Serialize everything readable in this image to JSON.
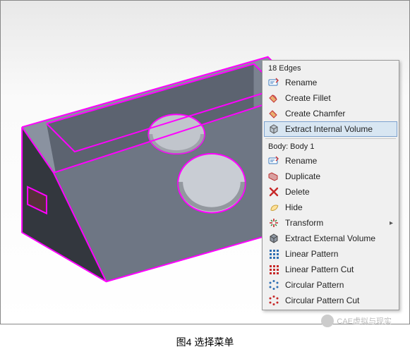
{
  "caption": "图4 选择菜单",
  "watermark_text": "CAE虚拟与现实",
  "menu": {
    "header_edges": "18 Edges",
    "header_body": "Body: Body 1",
    "edges_items": {
      "rename": "Rename",
      "create_fillet": "Create Fillet",
      "create_chamfer": "Create Chamfer",
      "extract_internal_volume": "Extract Internal Volume"
    },
    "body_items": {
      "rename": "Rename",
      "duplicate": "Duplicate",
      "delete": "Delete",
      "hide": "Hide",
      "transform": "Transform",
      "extract_external_volume": "Extract External Volume",
      "linear_pattern": "Linear Pattern",
      "linear_pattern_cut": "Linear Pattern Cut",
      "circular_pattern": "Circular Pattern",
      "circular_pattern_cut": "Circular Pattern Cut"
    }
  }
}
